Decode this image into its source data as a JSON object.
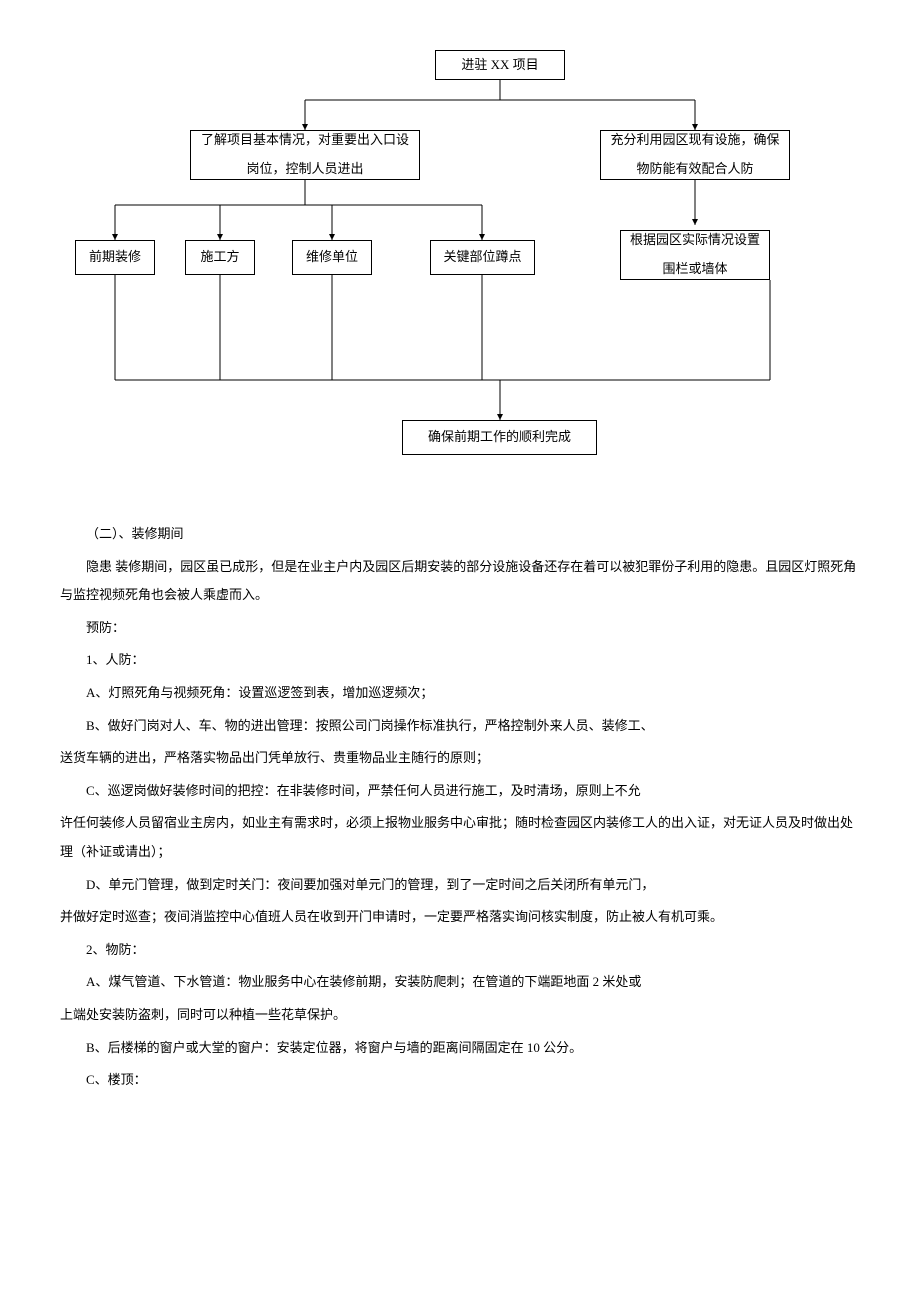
{
  "diagram": {
    "top": "进驻 XX 项目",
    "left_mid": "了解项目基本情况，对重要出入口设岗位，控制人员进出",
    "right_mid": "充分利用园区现有设施，确保物防能有效配合人防",
    "right_low": "根据园区实际情况设置围栏或墙体",
    "leaf1": "前期装修",
    "leaf2": "施工方",
    "leaf3": "维修单位",
    "leaf4": "关键部位蹲点",
    "bottom": "确保前期工作的顺利完成"
  },
  "body": {
    "h1": "（二）、装修期间",
    "p1": "隐患 装修期间，园区虽已成形，但是在业主户内及园区后期安装的部分设施设备还存在着可以被犯罪份子利用的隐患。且园区灯照死角与监控视频死角也会被人乘虚而入。",
    "p2": "预防：",
    "p3": "1、人防：",
    "p4": "A、灯照死角与视频死角：设置巡逻签到表，增加巡逻频次；",
    "p5": "B、做好门岗对人、车、物的进出管理：按照公司门岗操作标准执行，严格控制外来人员、装修工、",
    "p5b": "送货车辆的进出，严格落实物品出门凭单放行、贵重物品业主随行的原则；",
    "p6": "C、巡逻岗做好装修时间的把控：在非装修时间，严禁任何人员进行施工，及时清场，原则上不允",
    "p6b": "许任何装修人员留宿业主房内，如业主有需求时，必须上报物业服务中心审批；随时检查园区内装修工人的出入证，对无证人员及时做出处理（补证或请出）；",
    "p7": "D、单元门管理，做到定时关门：夜间要加强对单元门的管理，到了一定时间之后关闭所有单元门，",
    "p7b": "并做好定时巡查；夜间消监控中心值班人员在收到开门申请时，一定要严格落实询问核实制度，防止被人有机可乘。",
    "p8": "2、物防：",
    "p9": "A、煤气管道、下水管道：物业服务中心在装修前期，安装防爬刺；在管道的下端距地面 2 米处或",
    "p9b": "上端处安装防盗刺，同时可以种植一些花草保护。",
    "p10": "B、后楼梯的窗户或大堂的窗户：安装定位器，将窗户与墙的距离间隔固定在 10 公分。",
    "p11": "C、楼顶："
  }
}
